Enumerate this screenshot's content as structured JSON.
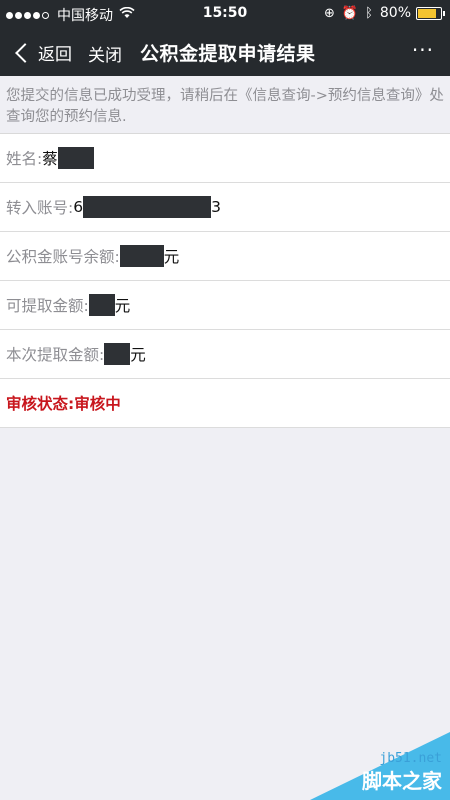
{
  "status_bar": {
    "carrier": "中国移动",
    "time": "15:50",
    "battery_text": "80%",
    "battery_level": 0.8,
    "signal_bars": 4,
    "signal_max": 5,
    "icons": [
      "wifi-icon",
      "orientation-lock-icon",
      "alarm-icon",
      "bluetooth-icon"
    ]
  },
  "nav": {
    "back_label": "返回",
    "close_label": "关闭",
    "title": "公积金提取申请结果",
    "more_label": "···"
  },
  "notice": "您提交的信息已成功受理，请稍后在《信息查询->预约信息查询》处查询您的预约信息.",
  "fields": [
    {
      "label": "姓名:",
      "value_prefix": "蔡",
      "value_suffix": ""
    },
    {
      "label": "转入账号:",
      "value_prefix": "6",
      "value_suffix": "3"
    },
    {
      "label": "公积金账号余额:",
      "value_prefix": "",
      "value_suffix": "元"
    },
    {
      "label": "可提取金额:",
      "value_prefix": "",
      "value_suffix": "元"
    },
    {
      "label": "本次提取金额:",
      "value_prefix": "",
      "value_suffix": "元"
    }
  ],
  "status": {
    "label": "审核状态:",
    "value": "审核中"
  },
  "watermark": {
    "site": "jb51.net",
    "name": "脚本之家"
  },
  "colors": {
    "bar_bg": "#262a2e",
    "page_bg": "#efeff4",
    "status_red": "#c8161d",
    "battery": "#f4c430"
  }
}
